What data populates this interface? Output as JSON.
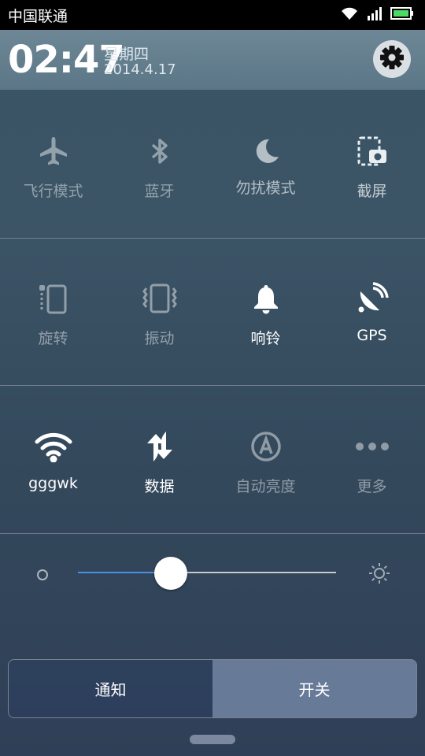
{
  "status_bar": {
    "carrier": "中国联通"
  },
  "header": {
    "time": "02:47",
    "weekday": "星期四",
    "date": "2014.4.17"
  },
  "toggles": [
    {
      "label": "飞行模式",
      "icon": "airplane-icon",
      "active": false
    },
    {
      "label": "蓝牙",
      "icon": "bluetooth-icon",
      "active": false
    },
    {
      "label": "勿扰模式",
      "icon": "moon-icon",
      "active": false
    },
    {
      "label": "截屏",
      "icon": "screenshot-icon",
      "active": true
    },
    {
      "label": "旋转",
      "icon": "rotate-icon",
      "active": false
    },
    {
      "label": "振动",
      "icon": "vibrate-icon",
      "active": false
    },
    {
      "label": "响铃",
      "icon": "bell-icon",
      "active": true
    },
    {
      "label": "GPS",
      "icon": "gps-icon",
      "active": true
    },
    {
      "label": "gggwk",
      "icon": "wifi-icon",
      "active": true
    },
    {
      "label": "数据",
      "icon": "data-icon",
      "active": true
    },
    {
      "label": "自动亮度",
      "icon": "auto-brightness-icon",
      "active": false
    },
    {
      "label": "更多",
      "icon": "more-icon",
      "active": false
    }
  ],
  "brightness": {
    "level": 0.36
  },
  "tabs": {
    "left": "通知",
    "right": "开关"
  },
  "colors": {
    "accent": "#4a90e2"
  }
}
